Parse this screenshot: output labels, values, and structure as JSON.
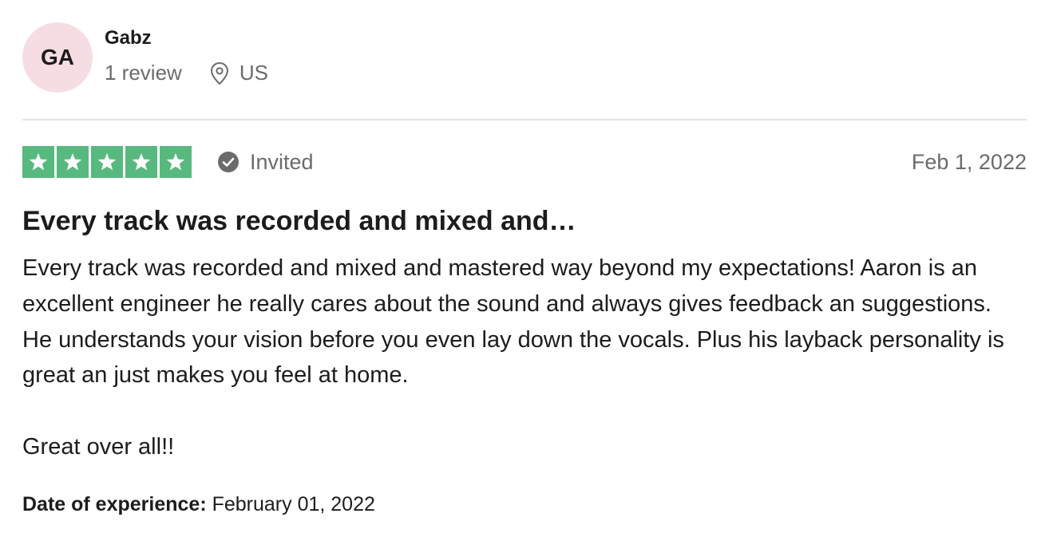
{
  "reviewer": {
    "initials": "GA",
    "name": "Gabz",
    "review_count": "1 review",
    "location": "US",
    "avatar_color": "#f6dce3"
  },
  "rating": {
    "stars": 5,
    "max_stars": 5,
    "star_color": "#58b97e",
    "star_icon": "star-icon"
  },
  "badge": {
    "label": "Invited",
    "icon": "check-circle-icon"
  },
  "review": {
    "date": "Feb 1, 2022",
    "title": "Every track was recorded and mixed and…",
    "body_paragraph_1": "Every track was recorded and mixed and mastered way beyond my expectations! Aaron is an excellent engineer he really cares about the sound and always gives feedback an suggestions. He understands your vision before you even lay down the vocals. Plus his layback personality is great an just makes you feel at home.",
    "body_paragraph_2": "Great over all!!"
  },
  "experience": {
    "label": "Date of experience:",
    "value": "February 01, 2022"
  }
}
